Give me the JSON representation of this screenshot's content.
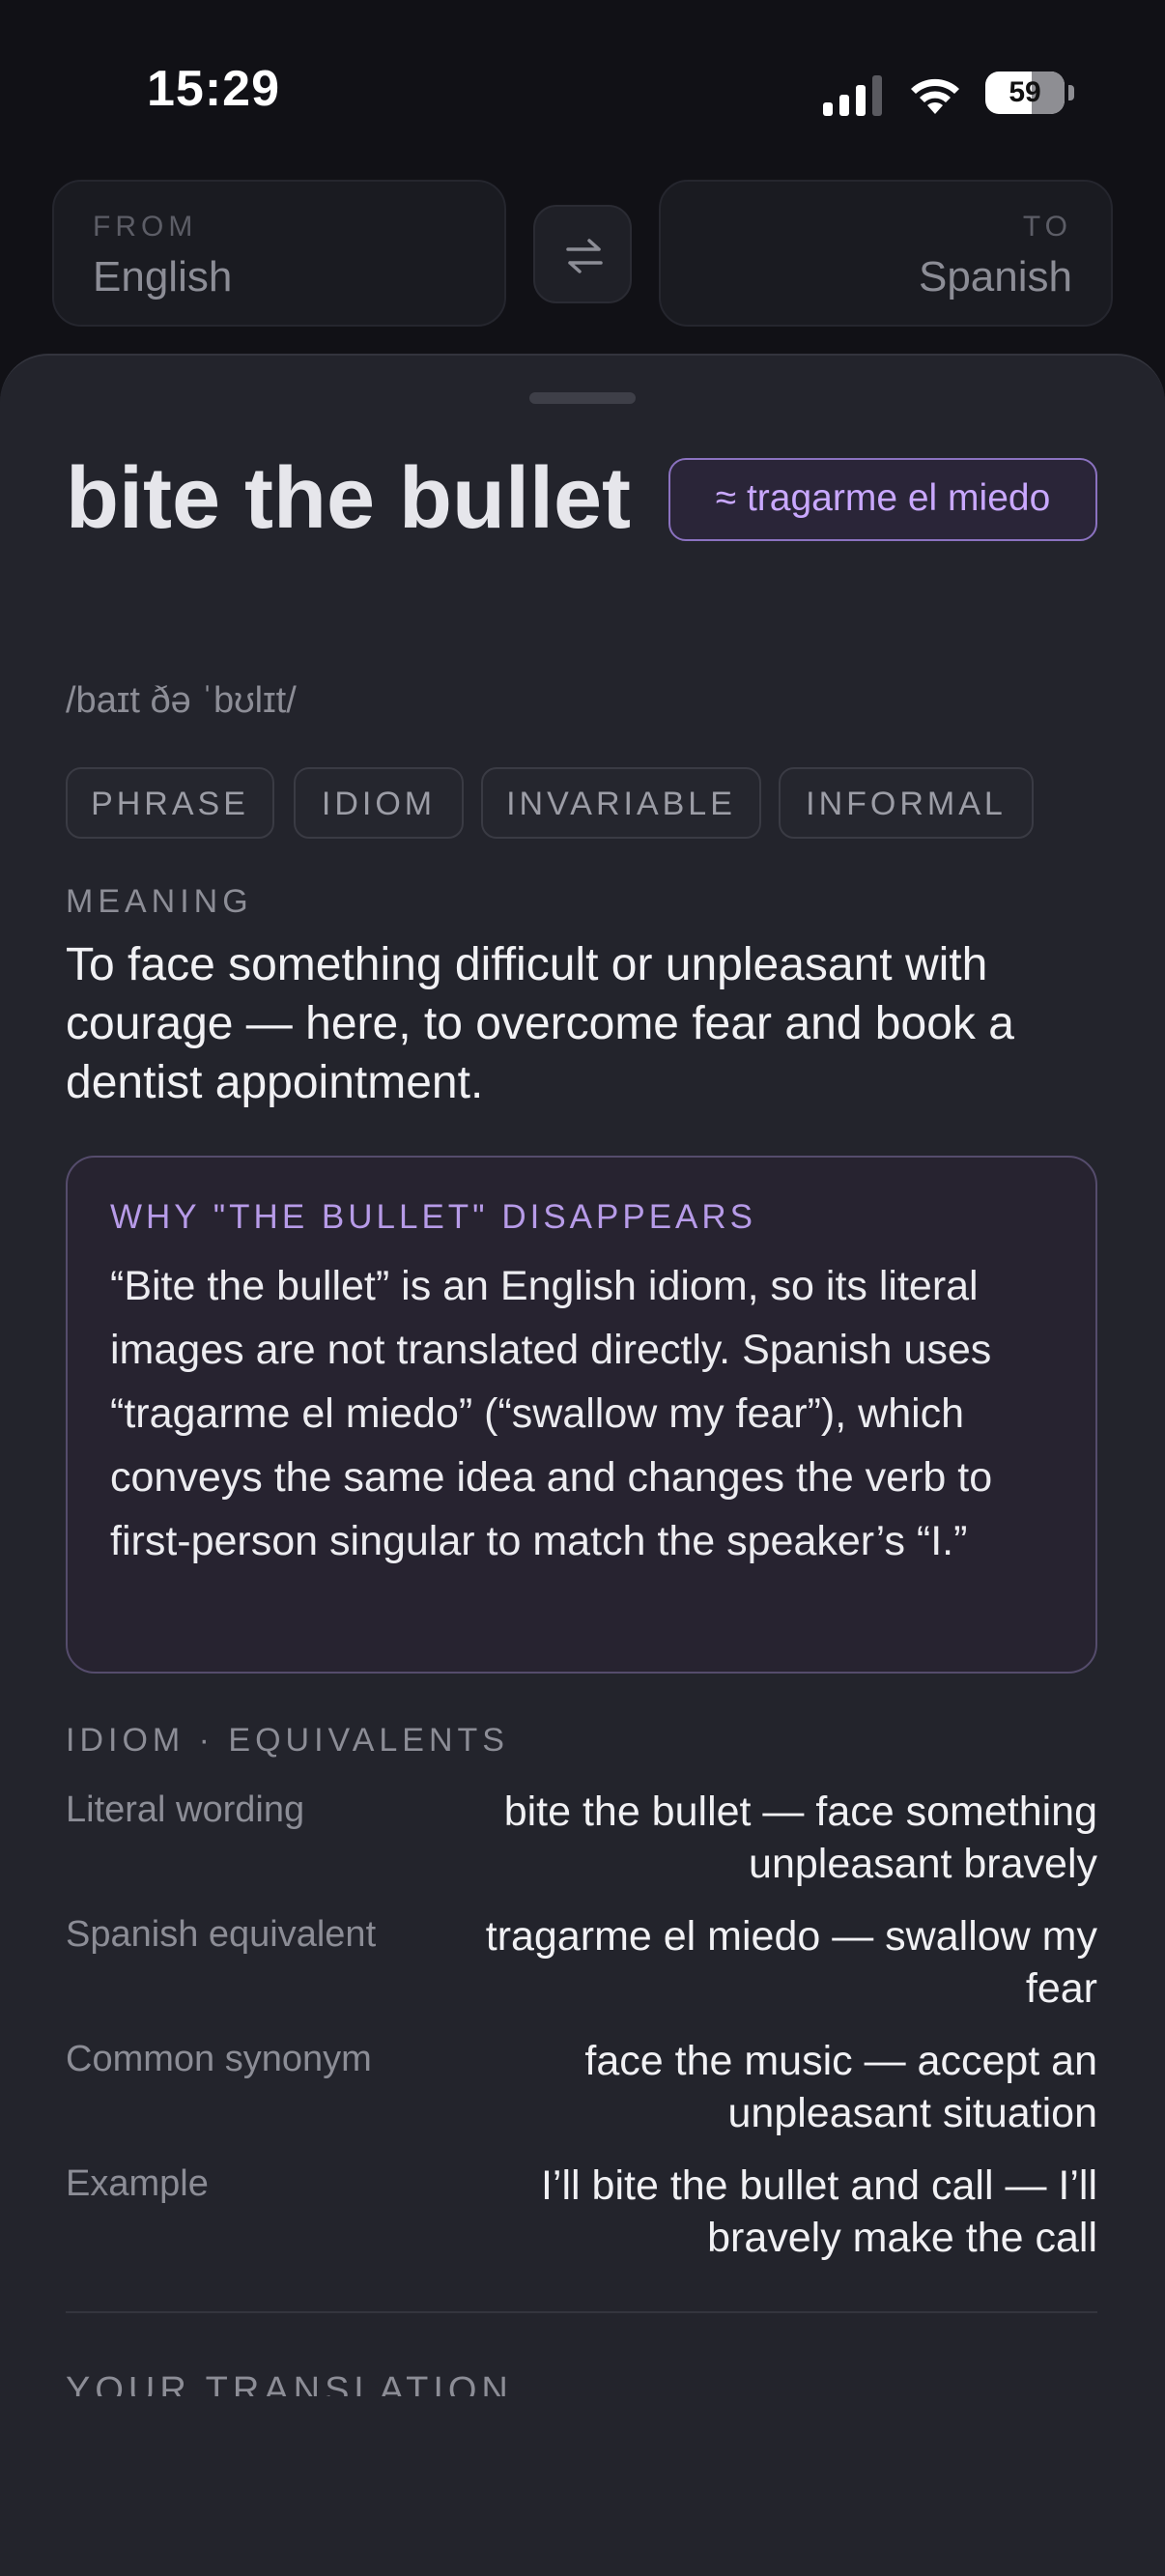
{
  "status": {
    "time": "15:29",
    "battery": "59"
  },
  "languages": {
    "from_caption": "FROM",
    "from_value": "English",
    "to_caption": "TO",
    "to_value": "Spanish"
  },
  "entry": {
    "headword": "bite the bullet",
    "pronunciation": "/baɪt ðə ˈbʊlɪt/",
    "equivalent_pill": "≈ tragarme el miedo",
    "tags": [
      "PHRASE",
      "IDIOM",
      "INVARIABLE",
      "INFORMAL"
    ]
  },
  "meaning": {
    "label": "MEANING",
    "text": "To face something difficult or unpleasant with courage — here, to overcome fear and book a dentist appointment."
  },
  "why": {
    "title": "WHY \"THE BULLET\" DISAPPEARS",
    "text": "“Bite the bullet” is an English idiom, so its literal images are not translated directly. Spanish uses “tragarme el miedo” (“swallow my fear”), which conveys the same idea and changes the verb to first-person singular to match the speaker’s “I.”"
  },
  "equivalents": {
    "label": "IDIOM · EQUIVALENTS",
    "rows": [
      {
        "key": "Literal wording",
        "value": "bite the bullet — face something unpleasant bravely"
      },
      {
        "key": "Spanish equivalent",
        "value": "tragarme el miedo — swallow my fear"
      },
      {
        "key": "Common synonym",
        "value": "face the music — accept an unpleasant situation"
      },
      {
        "key": "Example",
        "value": "I’ll bite the bullet and call — I’ll bravely make the call"
      }
    ]
  },
  "your_translation_label": "YOUR TRANSLATION",
  "colors": {
    "accent": "#C9A8FF",
    "sheet": "#23242C",
    "background": "#111116"
  }
}
